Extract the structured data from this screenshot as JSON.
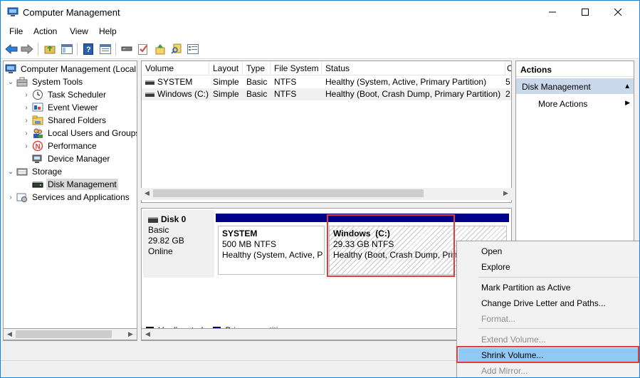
{
  "window": {
    "title": "Computer Management",
    "controls": {
      "minimize": "minimize-icon",
      "maximize": "maximize-icon",
      "close": "close-icon"
    }
  },
  "menubar": [
    "File",
    "Action",
    "View",
    "Help"
  ],
  "toolbar": {
    "icons": [
      "back-arrow-icon",
      "forward-arrow-icon",
      "up-folder-icon",
      "show-hide-tree-icon",
      "help-icon",
      "properties-icon",
      "connect-icon",
      "checklist-icon",
      "import-icon",
      "search-icon",
      "console-icon"
    ]
  },
  "tree": {
    "root": "Computer Management (Local",
    "system_tools": "System Tools",
    "task_scheduler": "Task Scheduler",
    "event_viewer": "Event Viewer",
    "shared_folders": "Shared Folders",
    "local_users": "Local Users and Groups",
    "performance": "Performance",
    "device_manager": "Device Manager",
    "storage": "Storage",
    "disk_management": "Disk Management",
    "services": "Services and Applications"
  },
  "volumes": {
    "columns": [
      "Volume",
      "Layout",
      "Type",
      "File System",
      "Status",
      "C"
    ],
    "rows": [
      {
        "volume": "SYSTEM",
        "layout": "Simple",
        "type": "Basic",
        "fs": "NTFS",
        "status": "Healthy (System, Active, Primary Partition)",
        "cap": "5"
      },
      {
        "volume": "Windows (C:)",
        "layout": "Simple",
        "type": "Basic",
        "fs": "NTFS",
        "status": "Healthy (Boot, Crash Dump, Primary Partition)",
        "cap": "2"
      }
    ]
  },
  "disk": {
    "name": "Disk 0",
    "type": "Basic",
    "size": "29.82 GB",
    "state": "Online",
    "partitions": [
      {
        "name": "SYSTEM",
        "size": "500 MB NTFS",
        "status": "Healthy (System, Active, P"
      },
      {
        "name": "Windows  (C:)",
        "size": "29.33 GB NTFS",
        "status": "Healthy (Boot, Crash Dump, Prim"
      }
    ],
    "legend": [
      {
        "label": "Unallocated",
        "color": "#000000"
      },
      {
        "label": "Primary partition",
        "color": "#00008b"
      }
    ]
  },
  "actions": {
    "title": "Actions",
    "section": "Disk Management",
    "more": "More Actions"
  },
  "context_menu": {
    "open": "Open",
    "explore": "Explore",
    "mark_active": "Mark Partition as Active",
    "change_letter": "Change Drive Letter and Paths...",
    "format": "Format...",
    "extend": "Extend Volume...",
    "shrink": "Shrink Volume...",
    "add_mirror": "Add Mirror..."
  },
  "colors": {
    "highlight_outline": "#e03c3c",
    "selection_blue": "#90c8f6",
    "primary_partition": "#00008b",
    "actions_section_bg": "#c9d8ea"
  }
}
